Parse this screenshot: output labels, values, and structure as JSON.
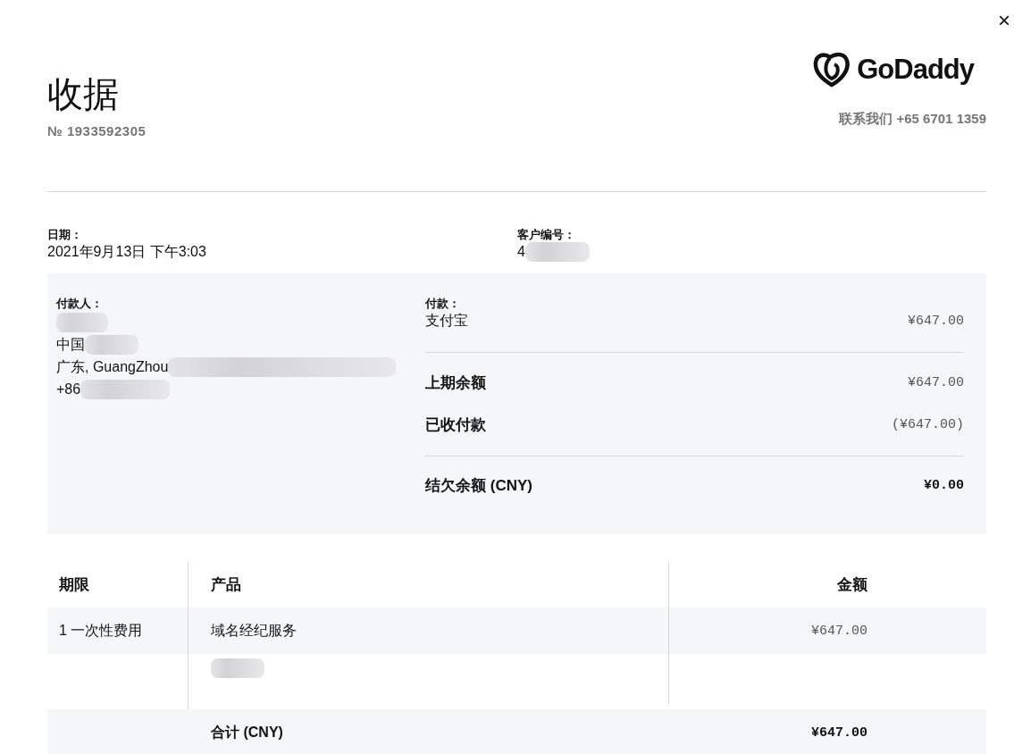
{
  "close": "×",
  "header": {
    "title": "收据",
    "number": "№ 1933592305",
    "logo_text": "GoDaddy",
    "contact": "联系我们 +65 6701 1359"
  },
  "date": {
    "label": "日期：",
    "value": "2021年9月13日 下午3:03"
  },
  "customer": {
    "label": "客户编号：",
    "value": "4",
    "redacted": true
  },
  "payer": {
    "label": "付款人：",
    "lines": [
      {
        "redacted": true
      },
      {
        "text": "中国",
        "redacted": true
      },
      {
        "text": "广东, GuangZhou",
        "redacted": true
      },
      {
        "text": "+86",
        "redacted": true
      }
    ]
  },
  "payment": {
    "label": "付款：",
    "method": "支付宝",
    "amount": "¥647.00"
  },
  "summary": [
    {
      "label": "上期余额",
      "amount": "¥647.00"
    },
    {
      "label": "已收付款",
      "amount": "(¥647.00)"
    }
  ],
  "balance": {
    "label": "结欠余额 (CNY)",
    "amount": "¥0.00"
  },
  "table": {
    "columns": [
      "期限",
      "产品",
      "金额"
    ],
    "rows": [
      {
        "term": "1 一次性费用",
        "product": "域名经纪服务",
        "amount": "¥647.00",
        "detail_redacted": true
      }
    ],
    "total": {
      "label": "合计 (CNY)",
      "amount": "¥647.00"
    }
  }
}
